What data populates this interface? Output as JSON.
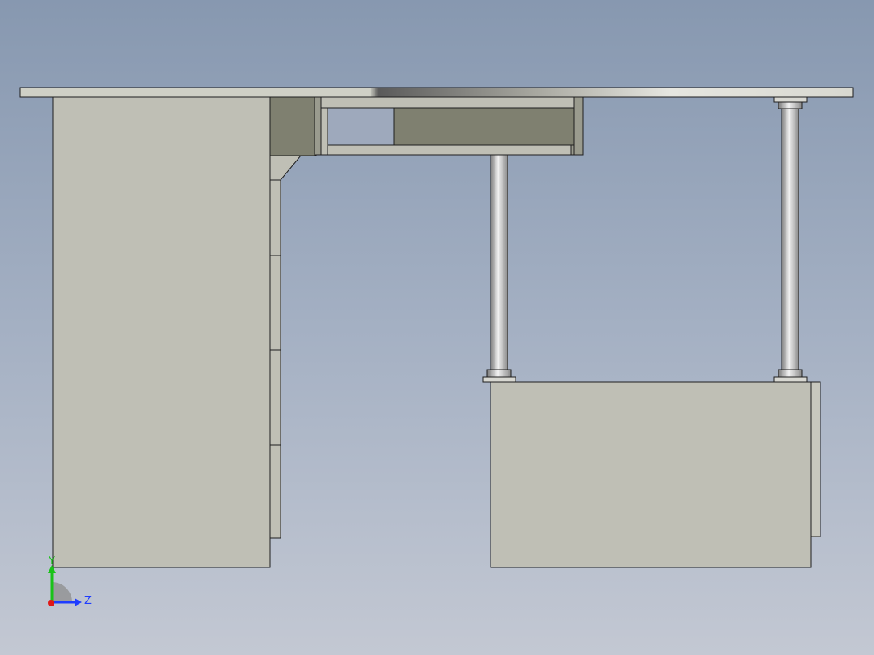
{
  "viewport": {
    "background_top": "#8798b0",
    "background_bottom": "#c3c8d3"
  },
  "model": {
    "part_color": "#bfbfb5",
    "shadow_color": "#7f8070",
    "edge_color": "#1e1e1e"
  },
  "triad": {
    "y_label": "Y",
    "z_label": "Z",
    "y_color": "#19c219",
    "z_color": "#1e3cff",
    "x_color": "#e01818"
  }
}
